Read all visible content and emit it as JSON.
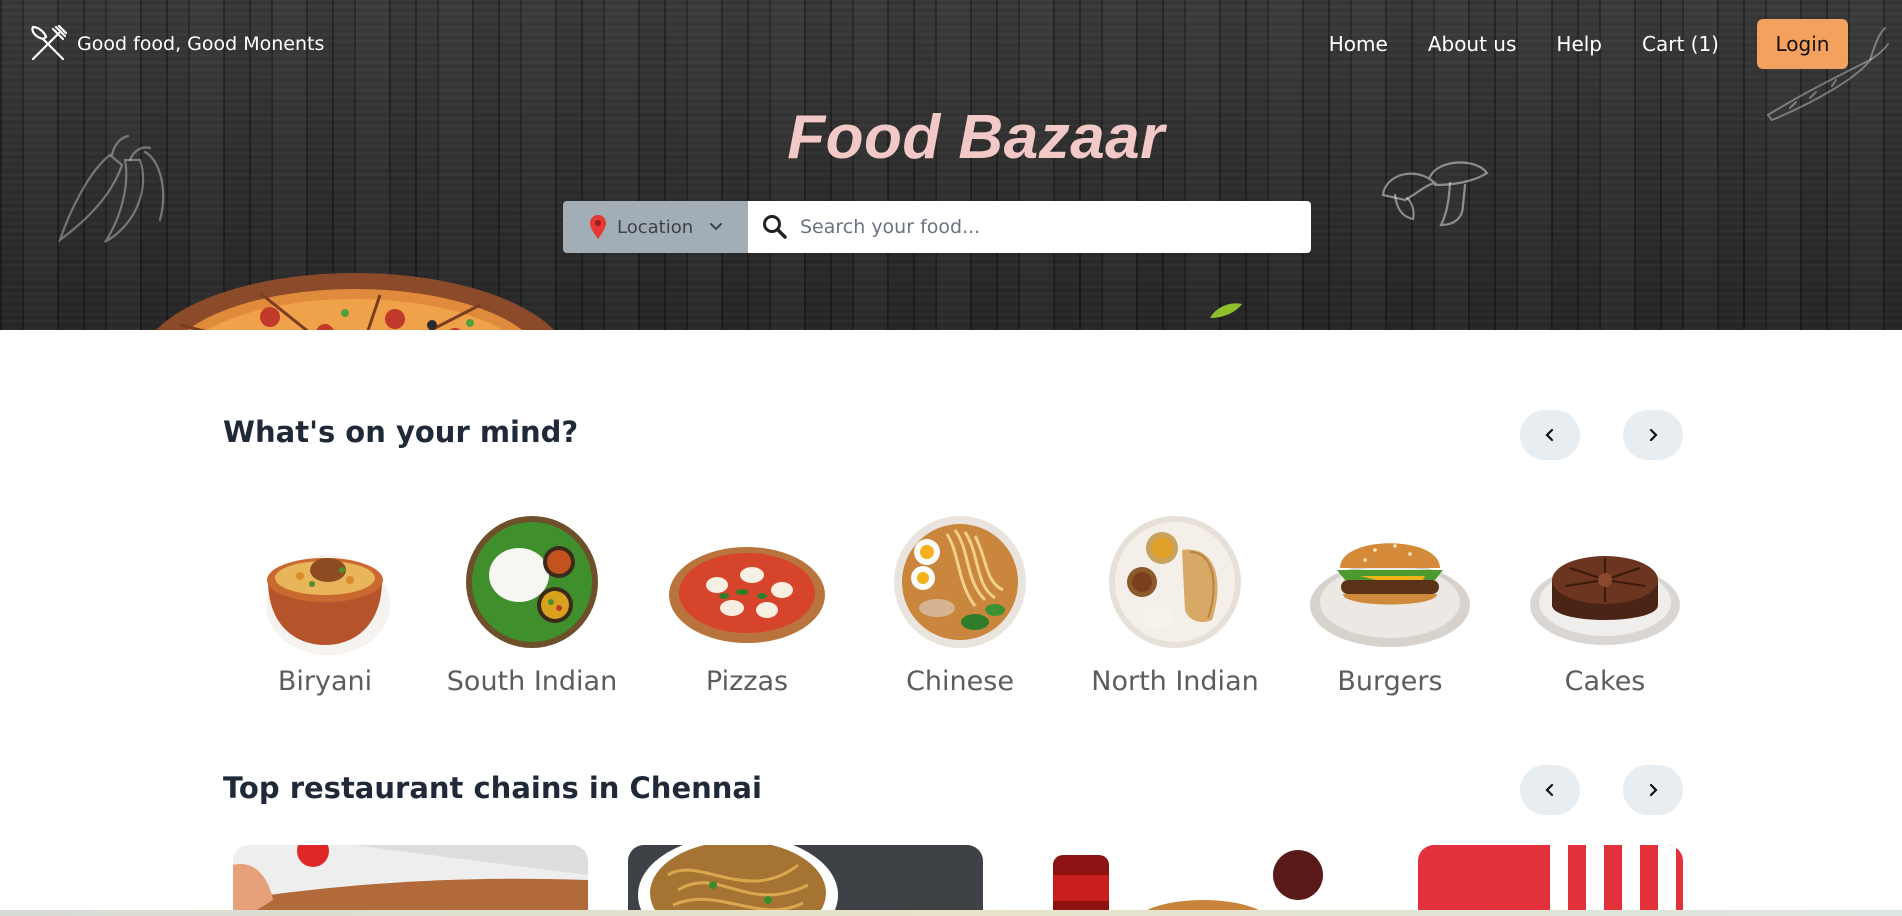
{
  "brand": {
    "name": "Good food, Good Monents"
  },
  "nav": {
    "links": [
      "Home",
      "About us",
      "Help",
      "Cart (1)"
    ],
    "login_label": "Login"
  },
  "hero": {
    "title": "Food Bazaar"
  },
  "search": {
    "location_label": "Location",
    "placeholder": "Search your food..."
  },
  "sections": {
    "whats_on_mind": {
      "title": "What's on your mind?",
      "categories": [
        "Biryani",
        "South Indian",
        "Pizzas",
        "Chinese",
        "North Indian",
        "Burgers",
        "Cakes"
      ]
    },
    "top_chains": {
      "title": "Top restaurant chains in Chennai"
    }
  },
  "colors": {
    "login_button": "#f4a15d",
    "hero_title": "#f2c9c6",
    "location_button": "#a3adb5",
    "arrow_button": "#e8edf2"
  }
}
